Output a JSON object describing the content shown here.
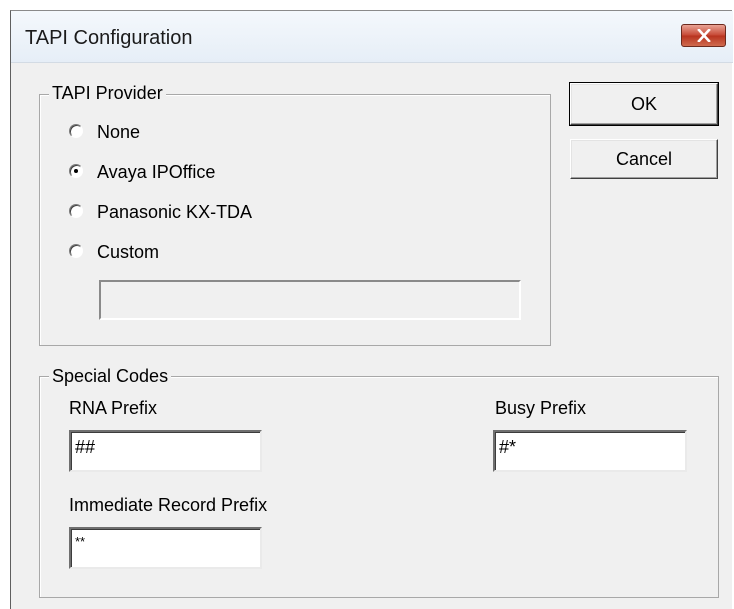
{
  "window": {
    "title": "TAPI Configuration",
    "close_icon": "close-x-icon"
  },
  "tapi_provider": {
    "legend": "TAPI Provider",
    "options": [
      {
        "label": "None",
        "selected": false
      },
      {
        "label": "Avaya IPOffice",
        "selected": true
      },
      {
        "label": "Panasonic KX-TDA",
        "selected": false
      },
      {
        "label": "Custom",
        "selected": false
      }
    ],
    "custom_value": ""
  },
  "buttons": {
    "ok_label": "OK",
    "cancel_label": "Cancel"
  },
  "special_codes": {
    "legend": "Special Codes",
    "rna_label": "RNA Prefix",
    "rna_value": "##",
    "busy_label": "Busy Prefix",
    "busy_value": "#*",
    "immediate_label": "Immediate Record Prefix",
    "immediate_value": "**"
  },
  "colors": {
    "dialog_bg": "#f0f0f0",
    "close_button": "#c74a37"
  }
}
